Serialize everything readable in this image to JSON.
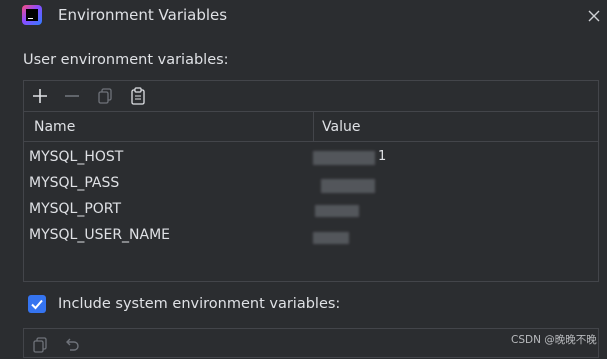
{
  "window": {
    "title": "Environment Variables",
    "app_icon": "jetbrains-app-icon",
    "close_icon": "close-icon"
  },
  "user_section": {
    "label": "User environment variables:",
    "toolbar": {
      "add_icon": "plus-icon",
      "remove_icon": "minus-icon",
      "copy_icon": "copy-icon",
      "paste_icon": "paste-icon"
    },
    "columns": [
      "Name",
      "Value"
    ],
    "rows": [
      {
        "name": "MYSQL_HOST",
        "value_hint": "1"
      },
      {
        "name": "MYSQL_PASS",
        "value_hint": ""
      },
      {
        "name": "MYSQL_PORT",
        "value_hint": ""
      },
      {
        "name": "MYSQL_USER_NAME",
        "value_hint": ""
      }
    ]
  },
  "system_section": {
    "include_label": "Include system environment variables:",
    "include_checked": true,
    "toolbar": {
      "copy_icon": "copy-icon",
      "undo_icon": "undo-icon"
    }
  },
  "watermark": "CSDN @晚晚不晚",
  "colors": {
    "background": "#2b2d30",
    "border": "#43454a",
    "text": "#dfe1e5",
    "accent": "#3574f0"
  }
}
